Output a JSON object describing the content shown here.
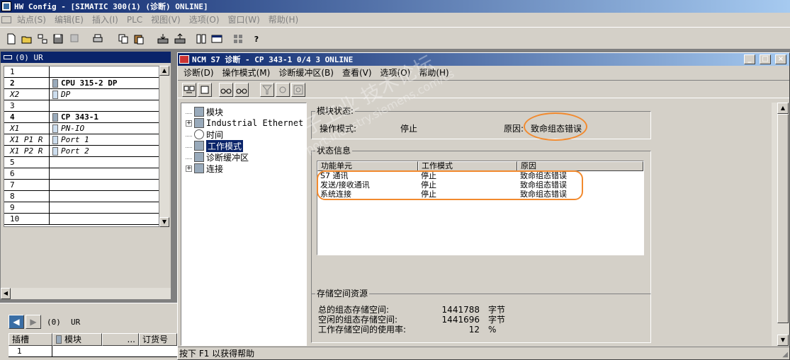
{
  "app": {
    "title": "HW Config - [SIMATIC 300(1) (诊断)  ONLINE]",
    "menus": [
      "站点(S)",
      "编辑(E)",
      "插入(I)",
      "PLC",
      "视图(V)",
      "选项(O)",
      "窗口(W)",
      "帮助(H)"
    ]
  },
  "rack": {
    "title": "(0) UR",
    "rows": [
      {
        "slot": "1",
        "module": ""
      },
      {
        "slot": "2",
        "module": "CPU 315-2 DP",
        "bold": true
      },
      {
        "slot": "X2",
        "module": "DP",
        "italic": true
      },
      {
        "slot": "3",
        "module": ""
      },
      {
        "slot": "4",
        "module": "CP 343-1",
        "bold": true
      },
      {
        "slot": "X1",
        "module": "PN-IO",
        "italic": true
      },
      {
        "slot": "X1 P1 R",
        "module": "Port 1",
        "italic": true
      },
      {
        "slot": "X1 P2 R",
        "module": "Port 2",
        "italic": true
      },
      {
        "slot": "5",
        "module": ""
      },
      {
        "slot": "6",
        "module": ""
      },
      {
        "slot": "7",
        "module": ""
      },
      {
        "slot": "8",
        "module": ""
      },
      {
        "slot": "9",
        "module": ""
      },
      {
        "slot": "10",
        "module": ""
      }
    ]
  },
  "bottom_panel": {
    "station": "(0)",
    "rack": "UR",
    "headers": [
      "插槽",
      "模块",
      "...",
      "订货号"
    ],
    "rows": [
      {
        "slot": "1"
      }
    ]
  },
  "ncm": {
    "title": "NCM S7 诊断 - CP 343-1 0/4 3  ONLINE",
    "menus": [
      "诊断(D)",
      "操作模式(M)",
      "诊断缓冲区(B)",
      "查看(V)",
      "选项(O)",
      "帮助(H)"
    ],
    "tree": [
      {
        "label": "模块",
        "selected": false,
        "expand": false
      },
      {
        "label": "Industrial Ethernet",
        "selected": false,
        "expand": true
      },
      {
        "label": "时间",
        "selected": false,
        "expand": false
      },
      {
        "label": "工作模式",
        "selected": true,
        "expand": false
      },
      {
        "label": "诊断缓冲区",
        "selected": false,
        "expand": false
      },
      {
        "label": "连接",
        "selected": false,
        "expand": true
      }
    ],
    "module_status": {
      "title": "模块状态:",
      "mode_label": "操作模式:",
      "mode_value": "停止",
      "reason_label": "原因:",
      "reason_value": "致命组态错误"
    },
    "status_info": {
      "title": "状态信息",
      "headers": [
        "功能单元",
        "工作模式",
        "原因"
      ],
      "rows": [
        {
          "unit": "S7 通讯",
          "mode": "停止",
          "reason": "致命组态错误"
        },
        {
          "unit": "发送/接收通讯",
          "mode": "停止",
          "reason": "致命组态错误"
        },
        {
          "unit": "系统连接",
          "mode": "停止",
          "reason": "致命组态错误"
        }
      ]
    },
    "memory": {
      "title": "存储空间资源",
      "rows": [
        {
          "label": "总的组态存储空间:",
          "value": "1441788",
          "unit": "字节"
        },
        {
          "label": "空闲的组态存储空间:",
          "value": "1441696",
          "unit": "字节"
        },
        {
          "label": "工作存储空间的使用率:",
          "value": "12",
          "unit": "%"
        }
      ]
    },
    "status_bar": "按下 F1 以获得帮助"
  },
  "watermark": {
    "line1": "西门子工业  技术论坛",
    "line2": "support.industry.siemens.com/cs"
  },
  "colors": {
    "highlight": "#f28a2e",
    "title_start": "#0a246a",
    "title_end": "#a6caf0",
    "face": "#d4d0c8"
  }
}
